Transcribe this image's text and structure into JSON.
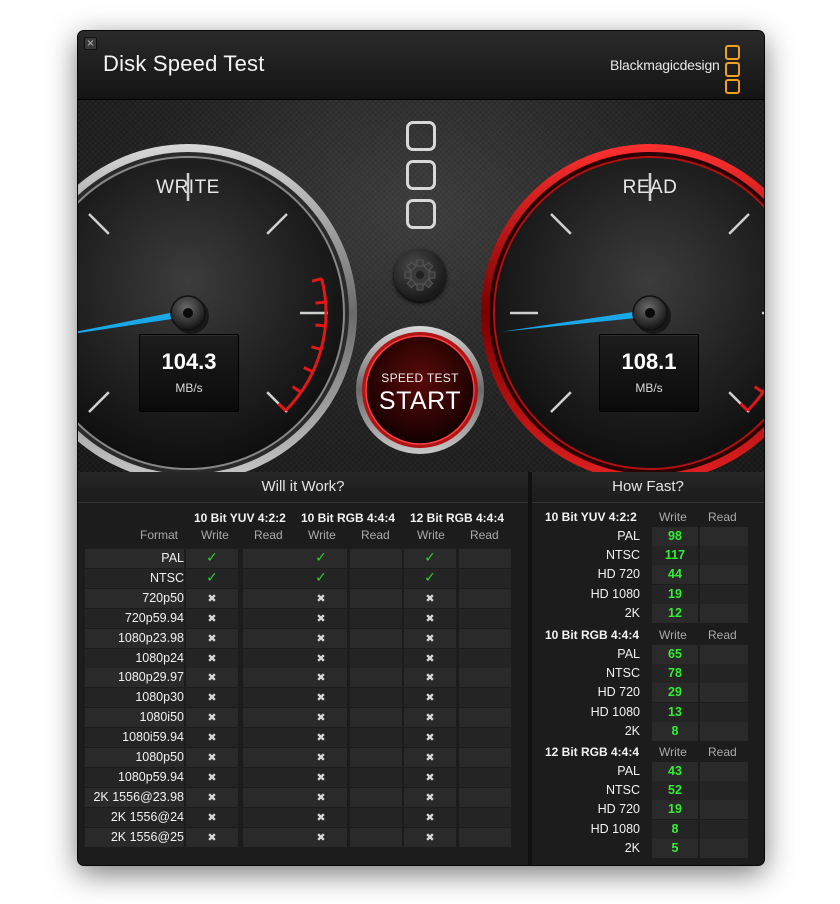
{
  "window": {
    "title": "Disk Speed Test",
    "close_glyph": "×"
  },
  "brand": {
    "name": "Blackmagicdesign",
    "logo_icon": "blackmagic-logo-icon"
  },
  "colors": {
    "needle": "#1aa8e8",
    "check": "#2fd02f",
    "value_green": "#33ee33",
    "red_zone": "#d81818",
    "accent": "#f0a020"
  },
  "write_gauge": {
    "label": "WRITE",
    "value": "104.3",
    "unit": "MB/s",
    "needle_fraction": 0.13
  },
  "read_gauge": {
    "label": "READ",
    "value": "108.1",
    "unit": "MB/s",
    "needle_fraction": 0.14
  },
  "start_button": {
    "small": "SPEED TEST",
    "big": "START"
  },
  "settings": {
    "icon": "gear-icon"
  },
  "will_it_work": {
    "title": "Will it Work?",
    "format_header": "Format",
    "groups": [
      {
        "name": "10 Bit YUV 4:2:2",
        "write": "Write",
        "read": "Read"
      },
      {
        "name": "10 Bit RGB 4:4:4",
        "write": "Write",
        "read": "Read"
      },
      {
        "name": "12 Bit RGB 4:4:4",
        "write": "Write",
        "read": "Read"
      }
    ],
    "rows": [
      {
        "format": "PAL",
        "yuv": "✓",
        "rgb10": "✓",
        "rgb12": "✓"
      },
      {
        "format": "NTSC",
        "yuv": "✓",
        "rgb10": "✓",
        "rgb12": "✓"
      },
      {
        "format": "720p50",
        "yuv": "✖",
        "rgb10": "✖",
        "rgb12": "✖"
      },
      {
        "format": "720p59.94",
        "yuv": "✖",
        "rgb10": "✖",
        "rgb12": "✖"
      },
      {
        "format": "1080p23.98",
        "yuv": "✖",
        "rgb10": "✖",
        "rgb12": "✖"
      },
      {
        "format": "1080p24",
        "yuv": "✖",
        "rgb10": "✖",
        "rgb12": "✖"
      },
      {
        "format": "1080p29.97",
        "yuv": "✖",
        "rgb10": "✖",
        "rgb12": "✖"
      },
      {
        "format": "1080p30",
        "yuv": "✖",
        "rgb10": "✖",
        "rgb12": "✖"
      },
      {
        "format": "1080i50",
        "yuv": "✖",
        "rgb10": "✖",
        "rgb12": "✖"
      },
      {
        "format": "1080i59.94",
        "yuv": "✖",
        "rgb10": "✖",
        "rgb12": "✖"
      },
      {
        "format": "1080p50",
        "yuv": "✖",
        "rgb10": "✖",
        "rgb12": "✖"
      },
      {
        "format": "1080p59.94",
        "yuv": "✖",
        "rgb10": "✖",
        "rgb12": "✖"
      },
      {
        "format": "2K 1556@23.98",
        "yuv": "✖",
        "rgb10": "✖",
        "rgb12": "✖"
      },
      {
        "format": "2K 1556@24",
        "yuv": "✖",
        "rgb10": "✖",
        "rgb12": "✖"
      },
      {
        "format": "2K 1556@25",
        "yuv": "✖",
        "rgb10": "✖",
        "rgb12": "✖"
      }
    ]
  },
  "how_fast": {
    "title": "How Fast?",
    "groups": [
      {
        "name": "10 Bit YUV 4:2:2",
        "write": "Write",
        "read": "Read",
        "rows": [
          {
            "label": "PAL",
            "value": "98"
          },
          {
            "label": "NTSC",
            "value": "117"
          },
          {
            "label": "HD 720",
            "value": "44"
          },
          {
            "label": "HD 1080",
            "value": "19"
          },
          {
            "label": "2K",
            "value": "12"
          }
        ]
      },
      {
        "name": "10 Bit RGB 4:4:4",
        "write": "Write",
        "read": "Read",
        "rows": [
          {
            "label": "PAL",
            "value": "65"
          },
          {
            "label": "NTSC",
            "value": "78"
          },
          {
            "label": "HD 720",
            "value": "29"
          },
          {
            "label": "HD 1080",
            "value": "13"
          },
          {
            "label": "2K",
            "value": "8"
          }
        ]
      },
      {
        "name": "12 Bit RGB 4:4:4",
        "write": "Write",
        "read": "Read",
        "rows": [
          {
            "label": "PAL",
            "value": "43"
          },
          {
            "label": "NTSC",
            "value": "52"
          },
          {
            "label": "HD 720",
            "value": "19"
          },
          {
            "label": "HD 1080",
            "value": "8"
          },
          {
            "label": "2K",
            "value": "5"
          }
        ]
      }
    ]
  }
}
